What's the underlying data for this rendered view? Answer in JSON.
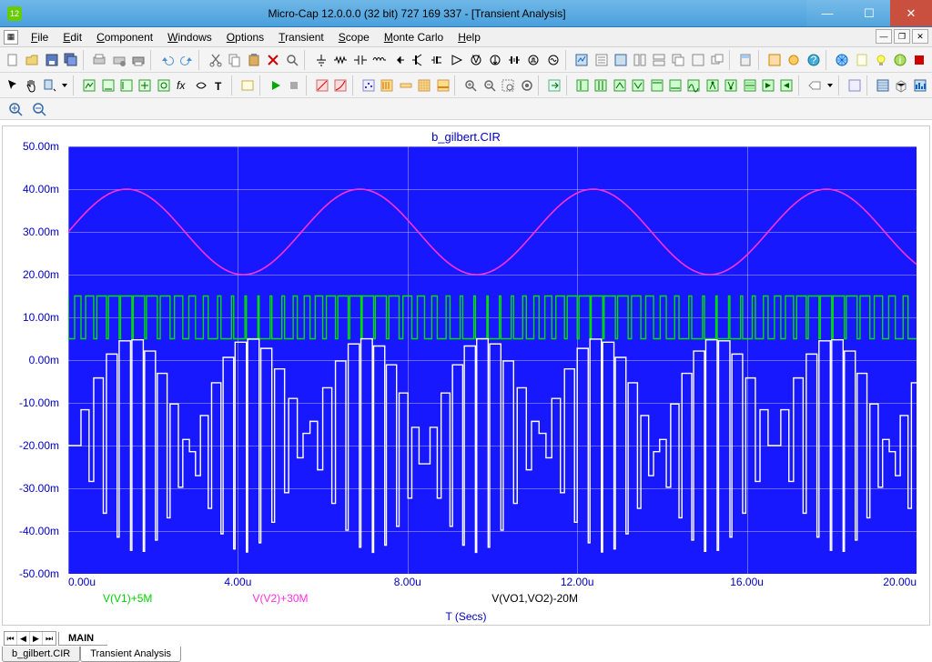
{
  "window": {
    "title": "Micro-Cap 12.0.0.0 (32 bit) 727 169 337 - [Transient Analysis]"
  },
  "menu": [
    "File",
    "Edit",
    "Component",
    "Windows",
    "Options",
    "Transient",
    "Scope",
    "Monte Carlo",
    "Help"
  ],
  "chart": {
    "title": "b_gilbert.CIR",
    "xaxis_title": "T (Secs)",
    "yticks": [
      "50.00m",
      "40.00m",
      "30.00m",
      "20.00m",
      "10.00m",
      "0.00m",
      "-10.00m",
      "-20.00m",
      "-30.00m",
      "-40.00m",
      "-50.00m"
    ],
    "xticks": [
      "0.00u",
      "4.00u",
      "8.00u",
      "12.00u",
      "16.00u",
      "20.00u"
    ],
    "legend": [
      {
        "text": "V(V1)+5M",
        "color": "#00d000"
      },
      {
        "text": "V(V2)+30M",
        "color": "#ff30e0"
      },
      {
        "text": "V(VO1,VO2)-20M",
        "color": "#000000"
      }
    ]
  },
  "tabs": {
    "main": "MAIN",
    "bottom": [
      "b_gilbert.CIR",
      "Transient Analysis"
    ]
  },
  "chart_data": {
    "type": "line",
    "xlabel": "T (Secs)",
    "ylabel": "",
    "xlim_us": [
      0,
      20
    ],
    "ylim_mv": [
      -50,
      50
    ],
    "series": [
      {
        "name": "V(V2)+30M",
        "color": "#ff30e0",
        "kind": "sine",
        "offset_mv": 30,
        "amp_mv": 10,
        "period_us": 5.5,
        "phase_us": 0
      },
      {
        "name": "V(V1)+5M",
        "color": "#00d000",
        "kind": "square_pwm_sine_mod",
        "offset_mv": 10,
        "low_mv": 5,
        "high_mv": 15,
        "base_period_us": 0.3,
        "mod_period_us": 5.5
      },
      {
        "name": "V(VO1,VO2)-20M",
        "color": "#ffffff",
        "kind": "sine_pwm_product",
        "offset_mv": -20,
        "amp_mv": 25,
        "env_period_us": 5.5,
        "carrier_period_us": 0.3
      }
    ]
  }
}
